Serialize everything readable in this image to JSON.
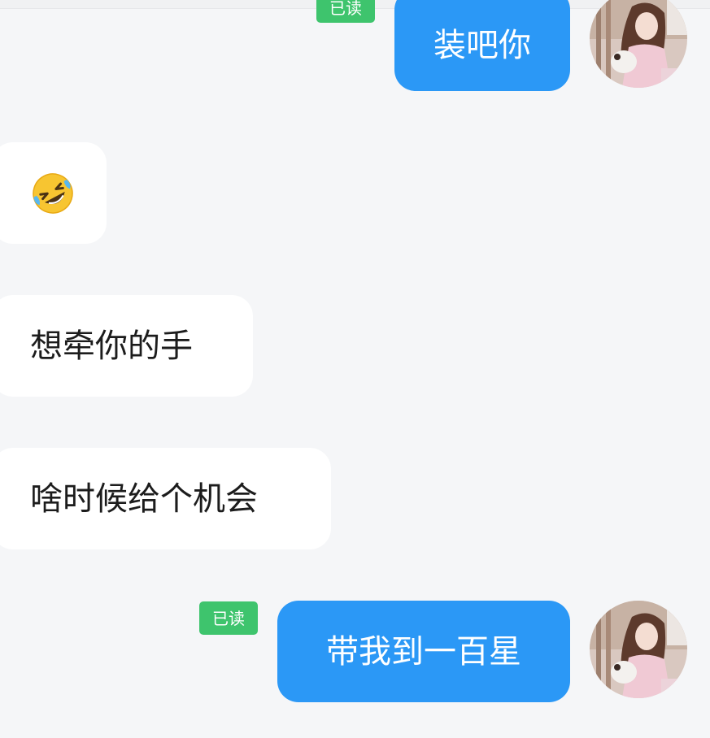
{
  "messages": [
    {
      "direction": "outgoing",
      "text": "装吧你",
      "status": "已读"
    },
    {
      "direction": "incoming",
      "icon": "rolling-on-floor-laughing-emoji"
    },
    {
      "direction": "incoming",
      "text": "想牵你的手"
    },
    {
      "direction": "incoming",
      "text": "啥时候给个机会"
    },
    {
      "direction": "outgoing",
      "text": "带我到一百星",
      "status": "已读"
    }
  ],
  "colors": {
    "background": "#f5f6f8",
    "outgoing_bubble": "#2b98f6",
    "incoming_bubble": "#ffffff",
    "read_badge": "#3ec46d"
  }
}
